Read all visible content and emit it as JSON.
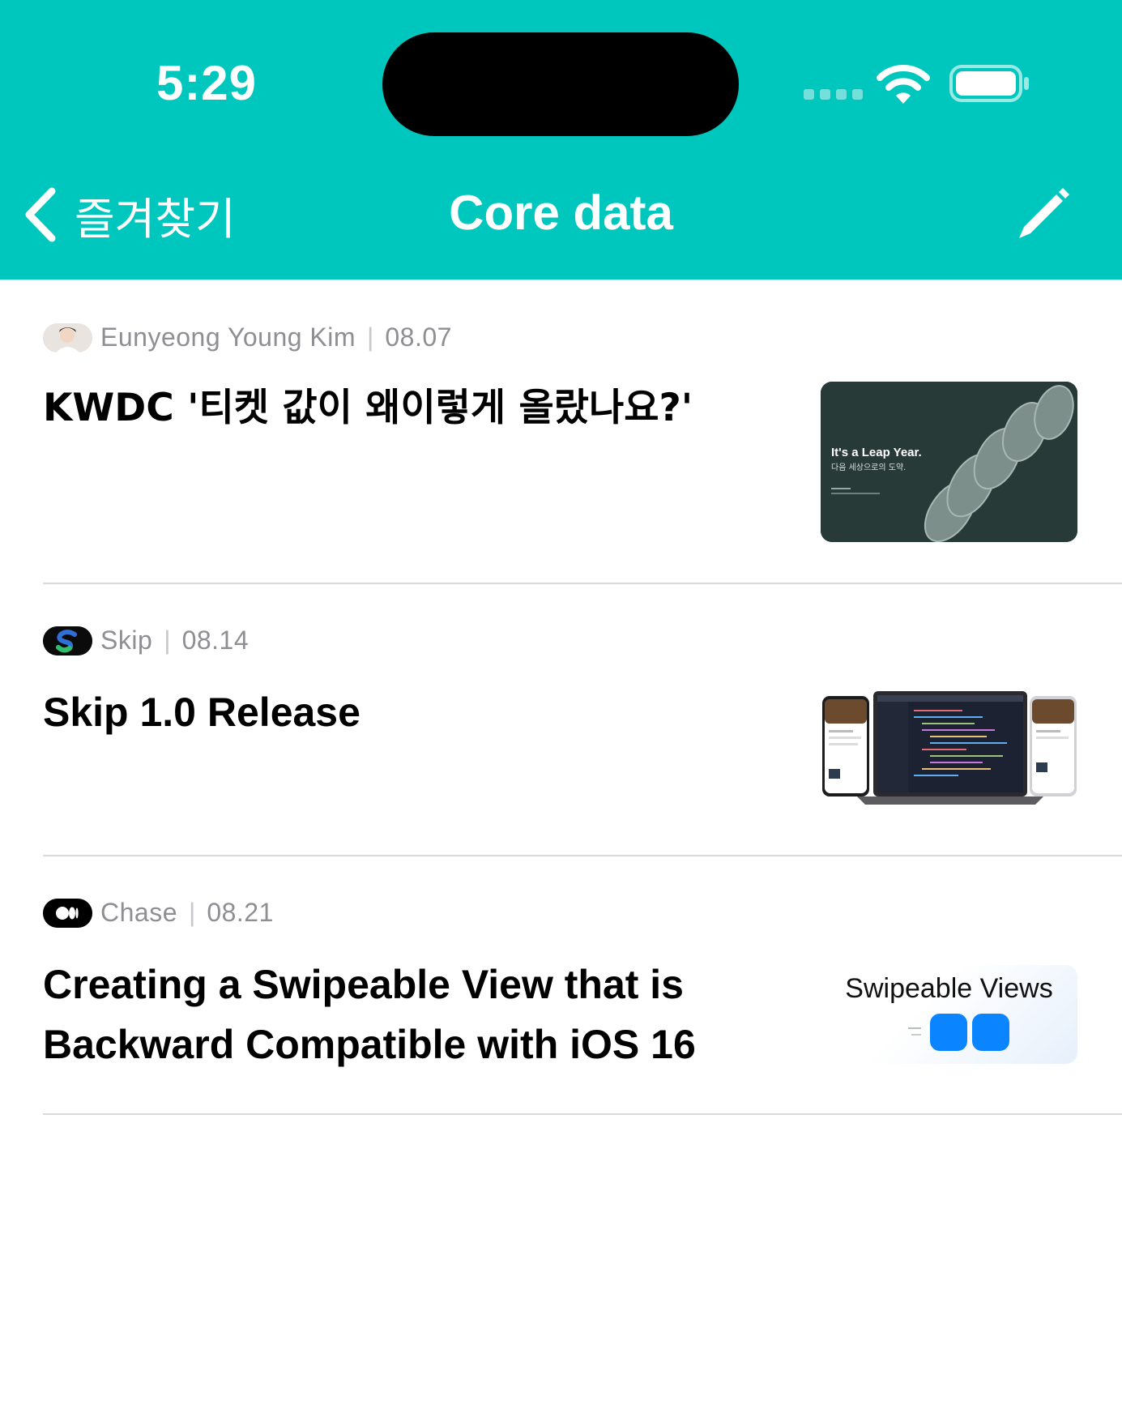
{
  "status_bar": {
    "time": "5:29"
  },
  "nav": {
    "back_label": "즐겨찾기",
    "title": "Core data"
  },
  "articles": [
    {
      "author": "Eunyeong Young Kim",
      "date": "08.07",
      "title": "KWDC '티켓 값이 왜이렇게 올랐나요?'",
      "thumb_text_1": "It's a Leap Year.",
      "thumb_text_2": "다음 세상으로의 도약."
    },
    {
      "author": "Skip",
      "date": "08.14",
      "title": "Skip 1.0 Release"
    },
    {
      "author": "Chase",
      "date": "08.21",
      "title": "Creating a Swipeable View that is Backward Compatible with iOS 16",
      "thumb_text_1": "Swipeable Views"
    }
  ]
}
